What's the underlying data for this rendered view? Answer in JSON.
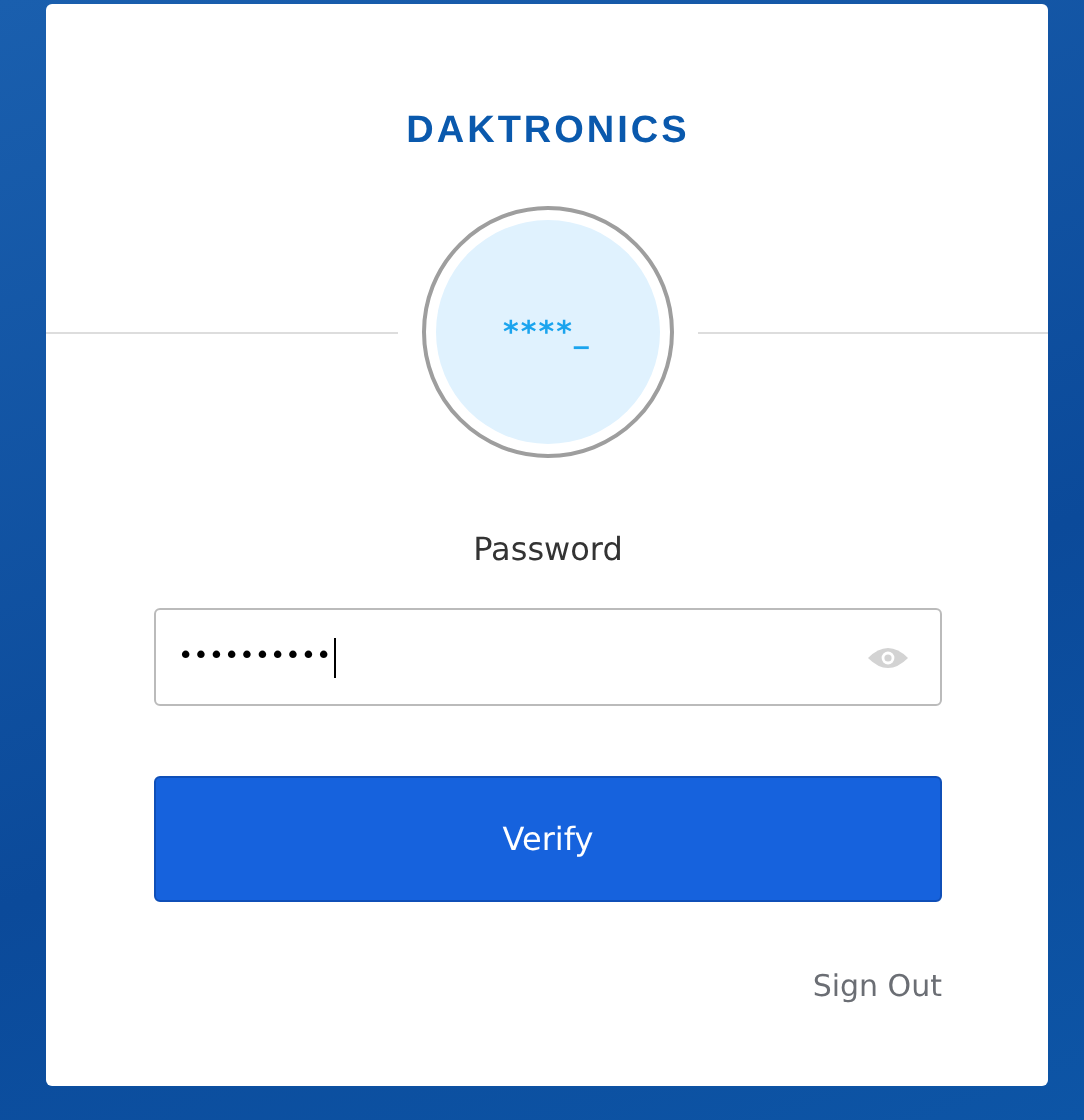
{
  "logo": "DAKTRONICS",
  "avatar": {
    "text": "****_"
  },
  "title": "Password",
  "password_field": {
    "value": "••••••••••"
  },
  "verify_button": "Verify",
  "sign_out_link": "Sign Out"
}
